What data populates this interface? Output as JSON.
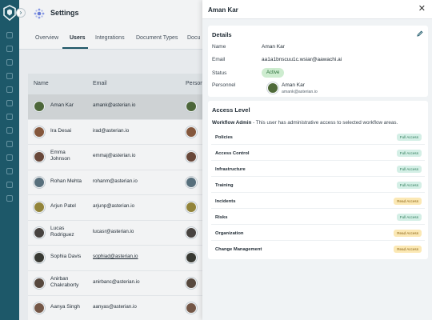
{
  "header": {
    "title": "Settings"
  },
  "tabs": [
    "Overview",
    "Users",
    "Integrations",
    "Document Types",
    "Docu"
  ],
  "table": {
    "columns": [
      "Name",
      "Email",
      "Person"
    ],
    "rows": [
      {
        "name": "Aman Kar",
        "email": "amank@asterian.io"
      },
      {
        "name": "Ira Desai",
        "email": "irad@asterian.io"
      },
      {
        "name": "Emma Johnson",
        "email": "emmaj@asterian.io"
      },
      {
        "name": "Rohan Mehta",
        "email": "rohanm@asterian.io"
      },
      {
        "name": "Arjun Patel",
        "email": "arjunp@asterian.io"
      },
      {
        "name": "Lucas Rodriguez",
        "email": "lucasr@asterian.io"
      },
      {
        "name": "Sophia Davis",
        "email": "sophiad@asterian.io"
      },
      {
        "name": "Anirban Chakraborty",
        "email": "anirbanc@asterian.io"
      },
      {
        "name": "Aanya Singh",
        "email": "aanyas@asterian.io"
      }
    ]
  },
  "drawer": {
    "title": "Aman Kar",
    "details": {
      "heading": "Details",
      "name_label": "Name",
      "name_value": "Aman Kar",
      "email_label": "Email",
      "email_value": "aa1a1bnscuu1c.wsiar@aawachi.ai",
      "status_label": "Status",
      "status_value": "Active",
      "personnel_label": "Personnel",
      "personnel_name": "Aman Kar",
      "personnel_email": "amank@asterian.io"
    },
    "access": {
      "heading": "Access Level",
      "role": "Workflow Admin",
      "description": " - This user has administrative access to selected workflow areas.",
      "items": [
        {
          "name": "Policies",
          "level": "Full Access"
        },
        {
          "name": "Access Control",
          "level": "Full Access"
        },
        {
          "name": "Infrastructure",
          "level": "Full Access"
        },
        {
          "name": "Training",
          "level": "Full Access"
        },
        {
          "name": "Incidents",
          "level": "Read Access"
        },
        {
          "name": "Risks",
          "level": "Full Access"
        },
        {
          "name": "Organization",
          "level": "Read Access"
        },
        {
          "name": "Change Management",
          "level": "Read Access"
        }
      ]
    }
  },
  "colors": {
    "brand": "#1d5869",
    "active": "#cdeccf",
    "full": "#d4efe6",
    "read": "#fbe8b4"
  },
  "icons": [
    "logo-icon",
    "settings-icon",
    "close-icon",
    "edit-icon",
    "avatar"
  ]
}
